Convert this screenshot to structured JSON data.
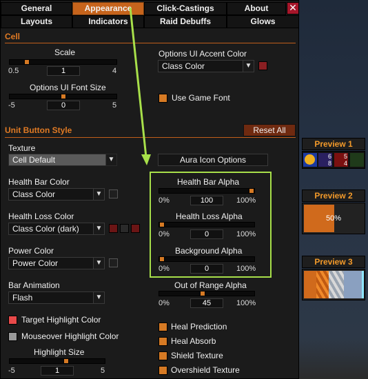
{
  "tabs_row1": [
    "General",
    "Appearance",
    "Click-Castings",
    "About"
  ],
  "tabs_row2": [
    "Layouts",
    "Indicators",
    "Raid Debuffs",
    "Glows"
  ],
  "active_tab": "Appearance",
  "close_label": "✕",
  "cell": {
    "title": "Cell",
    "scale": {
      "label": "Scale",
      "min": "0.5",
      "max": "4",
      "value": "1",
      "fraction": 0.14
    },
    "font_size": {
      "label": "Options UI Font Size",
      "min": "-5",
      "max": "5",
      "value": "0",
      "fraction": 0.5
    },
    "accent": {
      "label": "Options UI Accent Color",
      "value": "Class Color",
      "color": "#8a1f22"
    },
    "game_font": {
      "label": "Use Game Font",
      "checked": true
    }
  },
  "unit": {
    "title": "Unit Button Style",
    "reset_label": "Reset All",
    "texture": {
      "label": "Texture",
      "value": "Cell Default"
    },
    "health_bar_color": {
      "label": "Health Bar Color",
      "value": "Class Color"
    },
    "health_loss_color": {
      "label": "Health Loss Color",
      "value": "Class Color (dark)",
      "colors": [
        "#6b1515",
        "#2a2a2a",
        "#6b1515"
      ]
    },
    "power_color": {
      "label": "Power Color",
      "value": "Power Color"
    },
    "bar_animation": {
      "label": "Bar Animation",
      "value": "Flash"
    },
    "target_highlight": {
      "label": "Target Highlight Color",
      "color": "#e84a4a"
    },
    "mouseover_highlight": {
      "label": "Mouseover Highlight Color",
      "color": "#9a9a9a"
    },
    "highlight_size": {
      "label": "Highlight Size",
      "min": "-5",
      "max": "5",
      "value": "1",
      "fraction": 0.6
    },
    "aura_options_label": "Aura Icon Options",
    "health_bar_alpha": {
      "label": "Health Bar Alpha",
      "min": "0%",
      "max": "100%",
      "value": "100",
      "fraction": 1.0
    },
    "health_loss_alpha": {
      "label": "Health Loss Alpha",
      "min": "0%",
      "max": "100%",
      "value": "0",
      "fraction": 0.0
    },
    "background_alpha": {
      "label": "Background Alpha",
      "min": "0%",
      "max": "100%",
      "value": "0",
      "fraction": 0.0
    },
    "out_of_range_alpha": {
      "label": "Out of Range Alpha",
      "min": "0%",
      "max": "100%",
      "value": "45",
      "fraction": 0.45
    },
    "heal_prediction": {
      "label": "Heal Prediction",
      "checked": true
    },
    "heal_absorb": {
      "label": "Heal Absorb",
      "checked": true
    },
    "shield_texture": {
      "label": "Shield Texture",
      "checked": true
    },
    "overshield_texture": {
      "label": "Overshield Texture",
      "checked": true
    }
  },
  "previews": {
    "p1": {
      "title": "Preview 1",
      "counts": [
        "6",
        "8",
        "5",
        "4"
      ]
    },
    "p2": {
      "title": "Preview 2",
      "percent": "50%"
    },
    "p3": {
      "title": "Preview 3"
    }
  },
  "colors": {
    "accent": "#c6641c",
    "highlight_box": "#a8e04a"
  }
}
